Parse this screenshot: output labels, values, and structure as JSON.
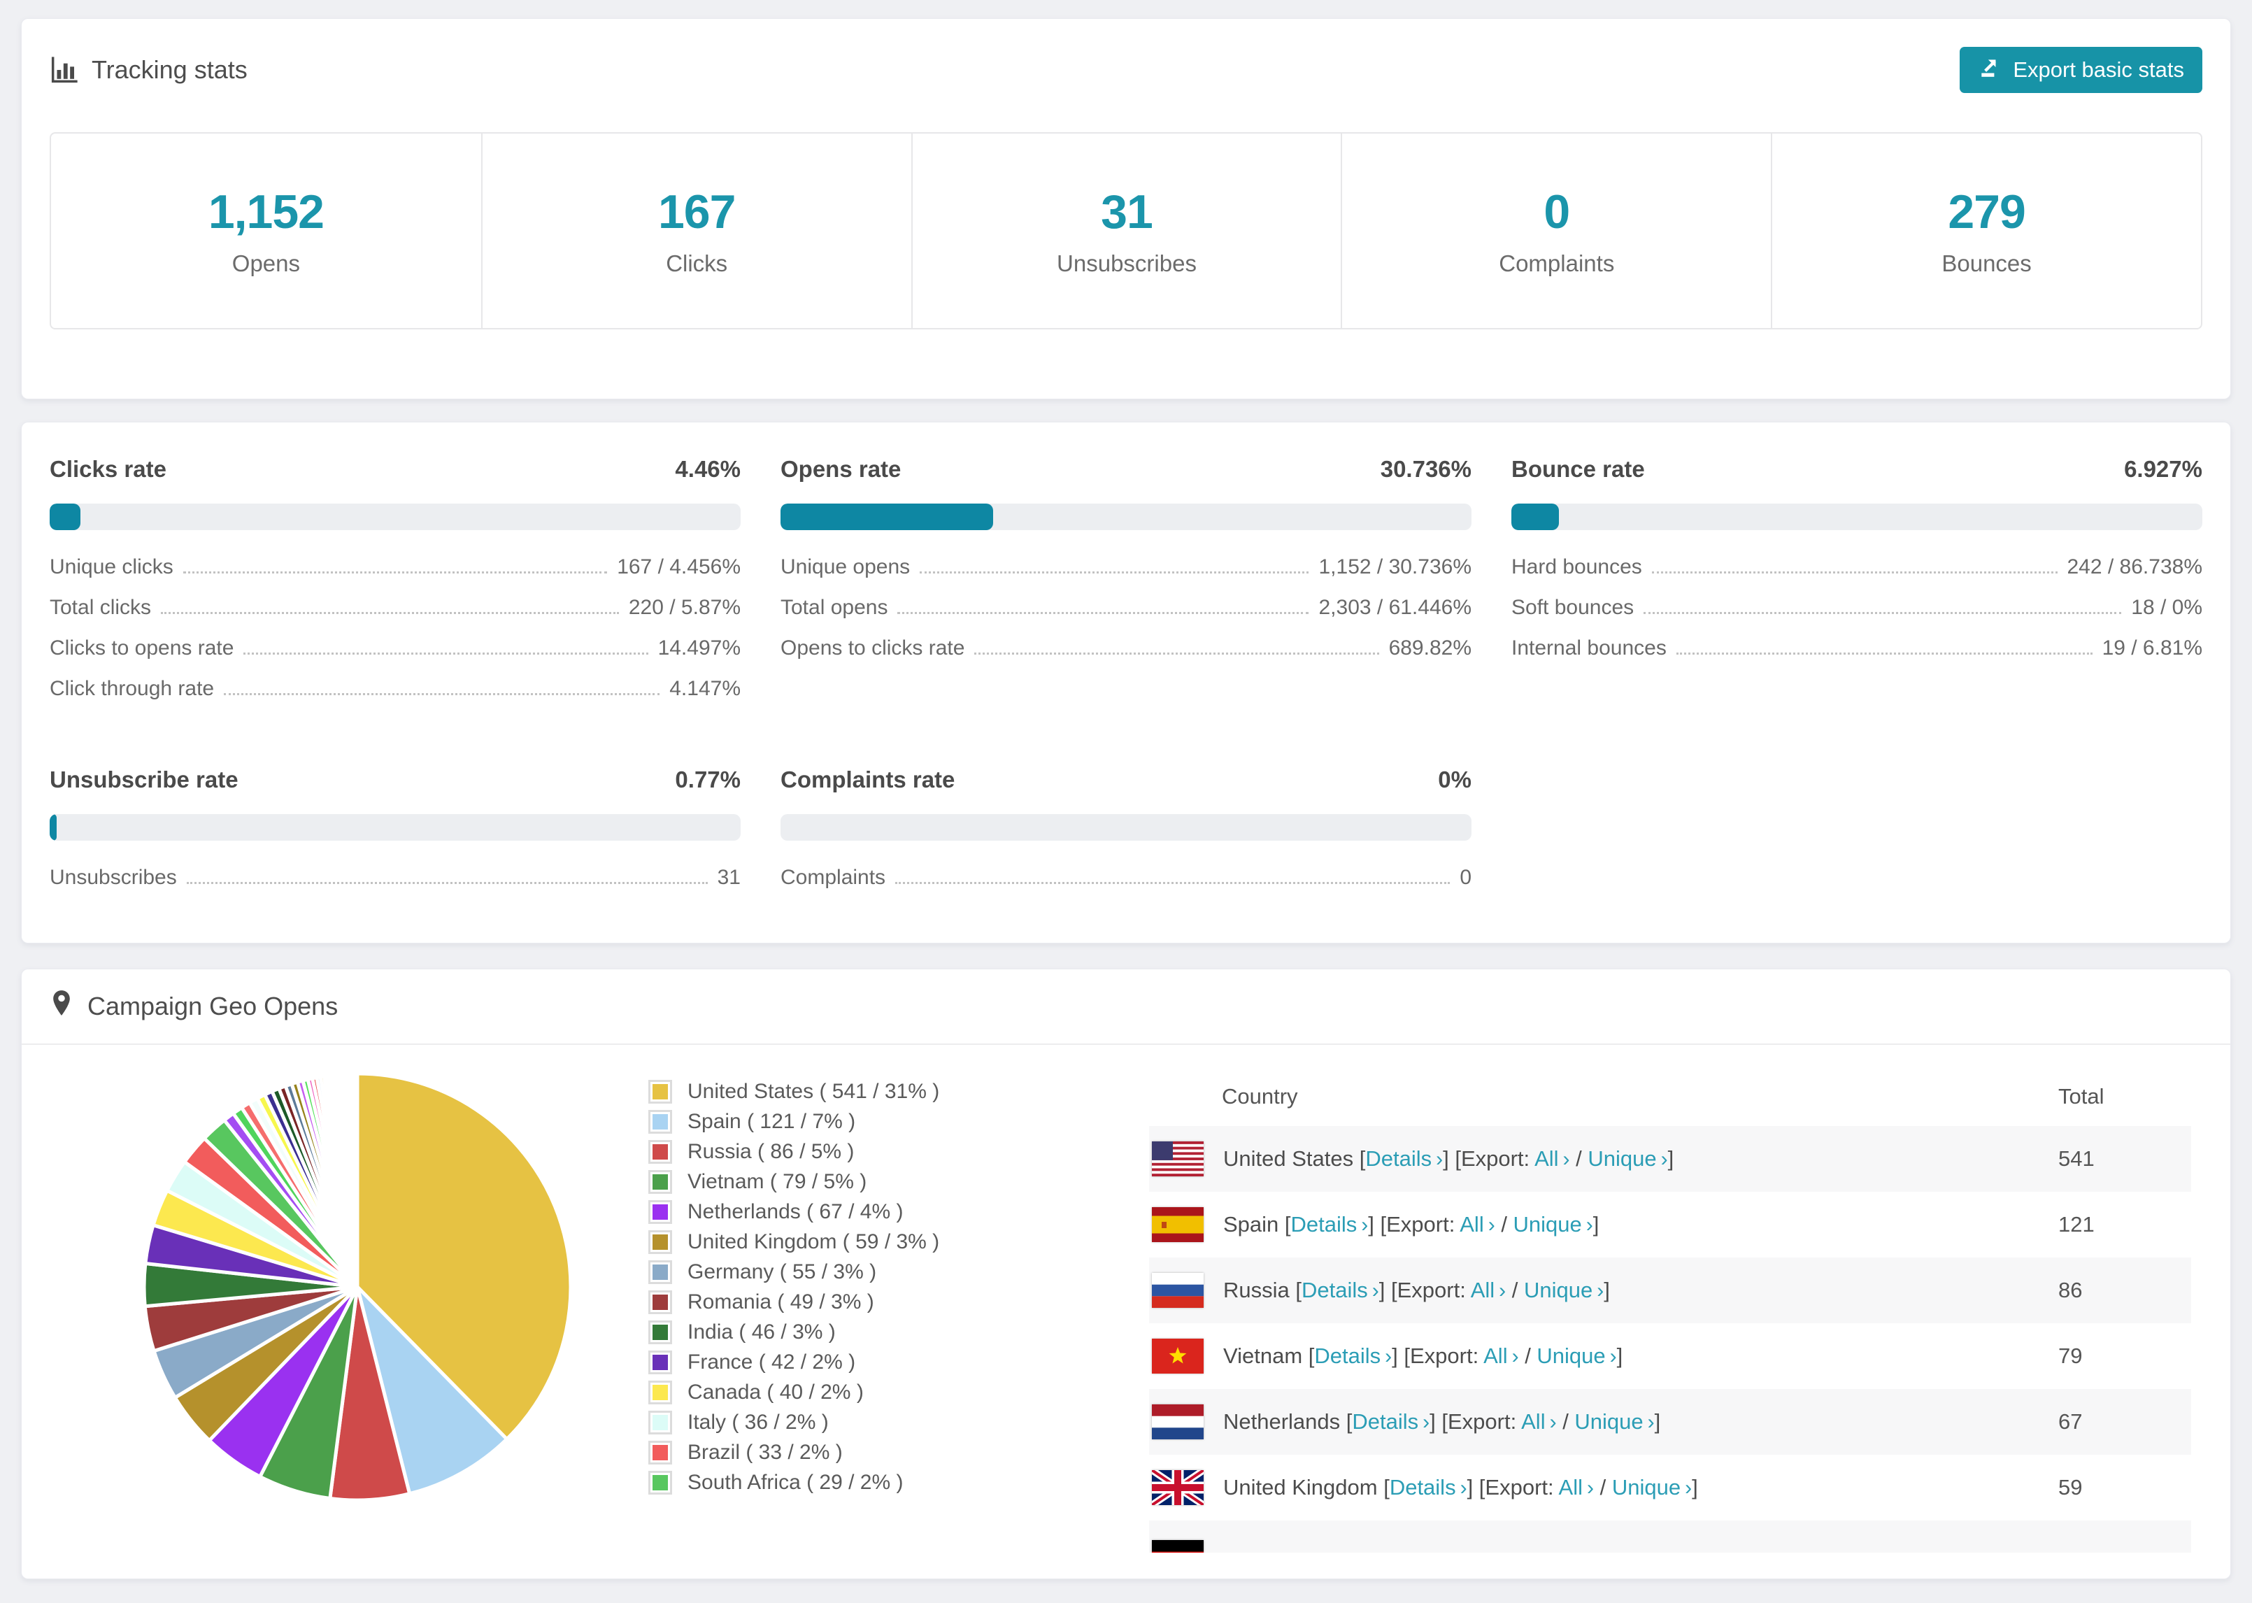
{
  "colors": {
    "accent": "#1793a7",
    "bar_fill": "#0e87a3",
    "link": "#2b9db5",
    "stripe": "#f7f7f8"
  },
  "tracking": {
    "title": "Tracking stats",
    "export_label": "Export basic stats",
    "stats": [
      {
        "value": "1,152",
        "label": "Opens"
      },
      {
        "value": "167",
        "label": "Clicks"
      },
      {
        "value": "31",
        "label": "Unsubscribes"
      },
      {
        "value": "0",
        "label": "Complaints"
      },
      {
        "value": "279",
        "label": "Bounces"
      }
    ]
  },
  "rates": [
    {
      "title": "Clicks rate",
      "value": "4.46%",
      "percent": 4.46,
      "rows": [
        {
          "label": "Unique clicks",
          "value": "167 / 4.456%"
        },
        {
          "label": "Total clicks",
          "value": "220 / 5.87%"
        },
        {
          "label": "Clicks to opens rate",
          "value": "14.497%"
        },
        {
          "label": "Click through rate",
          "value": "4.147%"
        }
      ]
    },
    {
      "title": "Opens rate",
      "value": "30.736%",
      "percent": 30.736,
      "rows": [
        {
          "label": "Unique opens",
          "value": "1,152 / 30.736%"
        },
        {
          "label": "Total opens",
          "value": "2,303 / 61.446%"
        },
        {
          "label": "Opens to clicks rate",
          "value": "689.82%"
        }
      ]
    },
    {
      "title": "Bounce rate",
      "value": "6.927%",
      "percent": 6.927,
      "rows": [
        {
          "label": "Hard bounces",
          "value": "242 / 86.738%"
        },
        {
          "label": "Soft bounces",
          "value": "18 / 0%"
        },
        {
          "label": "Internal bounces",
          "value": "19 / 6.81%"
        }
      ]
    },
    {
      "title": "Unsubscribe rate",
      "value": "0.77%",
      "percent": 0.77,
      "rows": [
        {
          "label": "Unsubscribes",
          "value": "31"
        }
      ]
    },
    {
      "title": "Complaints rate",
      "value": "0%",
      "percent": 0,
      "rows": [
        {
          "label": "Complaints",
          "value": "0"
        }
      ]
    }
  ],
  "geo": {
    "title": "Campaign Geo Opens",
    "legend": [
      {
        "name": "United States",
        "count": "541",
        "pct": "31%",
        "color": "#e6c243"
      },
      {
        "name": "Spain",
        "count": "121",
        "pct": "7%",
        "color": "#a9d3f2"
      },
      {
        "name": "Russia",
        "count": "86",
        "pct": "5%",
        "color": "#cf4a4a"
      },
      {
        "name": "Vietnam",
        "count": "79",
        "pct": "5%",
        "color": "#4ba04b"
      },
      {
        "name": "Netherlands",
        "count": "67",
        "pct": "4%",
        "color": "#9a31f0"
      },
      {
        "name": "United Kingdom",
        "count": "59",
        "pct": "3%",
        "color": "#b5912c"
      },
      {
        "name": "Germany",
        "count": "55",
        "pct": "3%",
        "color": "#8aaac8"
      },
      {
        "name": "Romania",
        "count": "49",
        "pct": "3%",
        "color": "#9e3c3c"
      },
      {
        "name": "India",
        "count": "46",
        "pct": "3%",
        "color": "#337a38"
      },
      {
        "name": "France",
        "count": "42",
        "pct": "2%",
        "color": "#6930b8"
      },
      {
        "name": "Canada",
        "count": "40",
        "pct": "2%",
        "color": "#fce84f"
      },
      {
        "name": "Italy",
        "count": "36",
        "pct": "2%",
        "color": "#dcfcf7"
      },
      {
        "name": "Brazil",
        "count": "33",
        "pct": "2%",
        "color": "#f25c5c"
      },
      {
        "name": "South Africa",
        "count": "29",
        "pct": "2%",
        "color": "#58c75f"
      }
    ],
    "table": {
      "country_header": "Country",
      "total_header": "Total",
      "details_label": "Details",
      "export_label": "Export:",
      "all_label": "All",
      "unique_label": "Unique",
      "arrow": "›",
      "rows": [
        {
          "country": "United States",
          "flag": "us",
          "total": "541"
        },
        {
          "country": "Spain",
          "flag": "es",
          "total": "121"
        },
        {
          "country": "Russia",
          "flag": "ru",
          "total": "86"
        },
        {
          "country": "Vietnam",
          "flag": "vn",
          "total": "79"
        },
        {
          "country": "Netherlands",
          "flag": "nl",
          "total": "67"
        },
        {
          "country": "United Kingdom",
          "flag": "gb",
          "total": "59"
        },
        {
          "country": "",
          "flag": "de",
          "total": "",
          "partial": true
        }
      ]
    }
  },
  "chart_data": {
    "type": "pie",
    "title": "Campaign Geo Opens",
    "legend_position": "right",
    "slices": [
      {
        "name": "United States",
        "value": 541,
        "pct": "31%",
        "color": "#e6c243"
      },
      {
        "name": "Spain",
        "value": 121,
        "pct": "7%",
        "color": "#a9d3f2"
      },
      {
        "name": "Russia",
        "value": 86,
        "pct": "5%",
        "color": "#cf4a4a"
      },
      {
        "name": "Vietnam",
        "value": 79,
        "pct": "5%",
        "color": "#4ba04b"
      },
      {
        "name": "Netherlands",
        "value": 67,
        "pct": "4%",
        "color": "#9a31f0"
      },
      {
        "name": "United Kingdom",
        "value": 59,
        "pct": "3%",
        "color": "#b5912c"
      },
      {
        "name": "Germany",
        "value": 55,
        "pct": "3%",
        "color": "#8aaac8"
      },
      {
        "name": "Romania",
        "value": 49,
        "pct": "3%",
        "color": "#9e3c3c"
      },
      {
        "name": "India",
        "value": 46,
        "pct": "3%",
        "color": "#337a38"
      },
      {
        "name": "France",
        "value": 42,
        "pct": "2%",
        "color": "#6930b8"
      },
      {
        "name": "Canada",
        "value": 40,
        "pct": "2%",
        "color": "#fce84f"
      },
      {
        "name": "Italy",
        "value": 36,
        "pct": "2%",
        "color": "#dcfcf7"
      },
      {
        "name": "Brazil",
        "value": 33,
        "pct": "2%",
        "color": "#f25c5c"
      },
      {
        "name": "South Africa",
        "value": 29,
        "pct": "2%",
        "color": "#58c75f"
      }
    ],
    "others": {
      "note": "remaining small countries, values estimated from slice angles",
      "values": [
        12,
        11,
        10,
        9.5,
        9,
        8.5,
        8,
        7.5,
        7,
        6.5,
        6,
        5.5,
        5,
        4.6,
        4.2,
        3.9,
        3.6,
        3.3,
        3,
        2.8,
        2.6,
        2.4,
        2.2,
        2,
        1.8,
        1.6,
        1.4,
        1.2,
        1.1,
        1,
        0.9,
        0.8,
        0.7,
        0.6,
        0.5,
        0.45,
        0.4,
        0.35,
        0.3,
        0.25,
        0.2,
        0.15,
        0.12,
        0.1,
        0.08
      ],
      "palette": [
        "#a44df2",
        "#50d45c",
        "#f56d6d",
        "#f2fdfb",
        "#f7f74d",
        "#3b2f90",
        "#1d5a28",
        "#7a2525",
        "#5c7b99",
        "#97821c",
        "#c45df0",
        "#58e05e",
        "#f061c0",
        "#e84545",
        "#d6ecfa",
        "#e2b836",
        "#8a63f0",
        "#35a040",
        "#f04f4f",
        "#bfe8f7"
      ]
    }
  }
}
